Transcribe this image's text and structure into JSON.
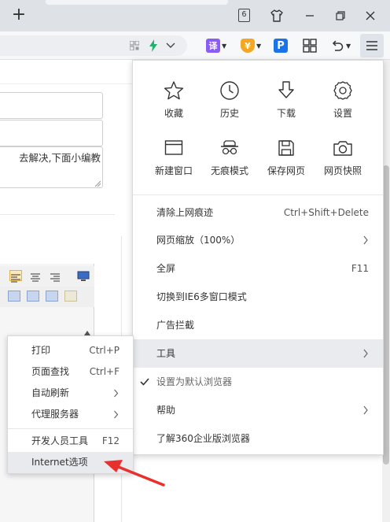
{
  "titlebar": {
    "tab_count": "6"
  },
  "main_menu": {
    "quick_actions": [
      {
        "label": "收藏",
        "icon": "star-icon"
      },
      {
        "label": "历史",
        "icon": "clock-icon"
      },
      {
        "label": "下载",
        "icon": "download-icon"
      },
      {
        "label": "设置",
        "icon": "gear-icon"
      },
      {
        "label": "新建窗口",
        "icon": "window-icon"
      },
      {
        "label": "无痕模式",
        "icon": "incognito-icon"
      },
      {
        "label": "保存网页",
        "icon": "save-icon"
      },
      {
        "label": "网页快照",
        "icon": "camera-icon"
      }
    ],
    "items": [
      {
        "label": "清除上网痕迹",
        "shortcut": "Ctrl+Shift+Delete"
      },
      {
        "label": "网页缩放（100%）",
        "shortcut": ""
      },
      {
        "label": "全屏",
        "shortcut": "F11"
      },
      {
        "label": "切换到IE6多窗口模式",
        "shortcut": ""
      },
      {
        "label": "广告拦截",
        "shortcut": ""
      },
      {
        "label": "工具",
        "shortcut": ""
      },
      {
        "label": "设置为默认浏览器",
        "shortcut": ""
      },
      {
        "label": "帮助",
        "shortcut": ""
      },
      {
        "label": "了解360企业版浏览器",
        "shortcut": ""
      }
    ]
  },
  "tools_submenu": {
    "items": [
      {
        "label": "打印",
        "shortcut": "Ctrl+P"
      },
      {
        "label": "页面查找",
        "shortcut": "Ctrl+F"
      },
      {
        "label": "自动刷新",
        "shortcut": ""
      },
      {
        "label": "代理服务器",
        "shortcut": ""
      },
      {
        "label": "开发人员工具",
        "shortcut": "F12"
      },
      {
        "label": "Internet选项",
        "shortcut": ""
      }
    ]
  },
  "page": {
    "textarea_text": "去解决,下面小编教"
  },
  "colors": {
    "annotation_arrow": "#e8312f",
    "translate_badge": "#8a5cf6",
    "yen_badge": "#f5a623",
    "p_badge": "#1a73e8",
    "bolt": "#21b36b"
  }
}
